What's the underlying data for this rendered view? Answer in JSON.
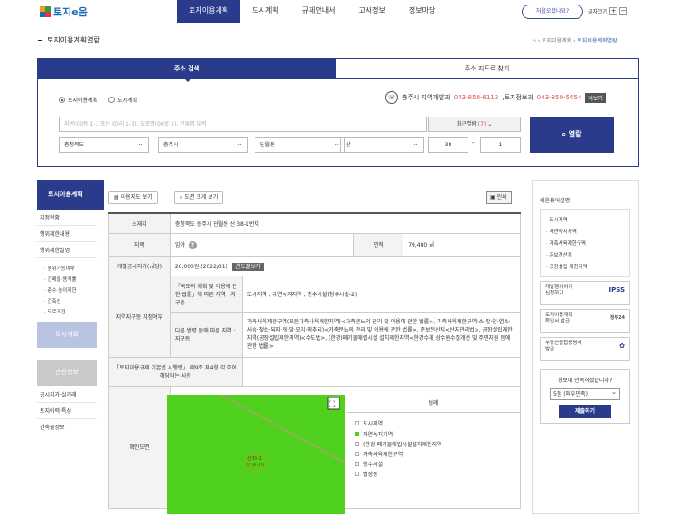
{
  "header": {
    "logo_text": "토지e음",
    "nav": [
      "토지이용계획",
      "도시계획",
      "규제안내서",
      "고시정보",
      "정보마당"
    ],
    "help_button": "처음오셨나요?",
    "font_size_label": "글자크기",
    "font_plus": "+",
    "font_minus": "−"
  },
  "page": {
    "title": "토지이용계획열람",
    "breadcrumb": [
      "토지이용계획",
      "토지이용계획열람"
    ]
  },
  "search": {
    "tab_address": "주소 검색",
    "tab_map": "주소 지도로 찾기",
    "radio_land_use": "토지이용계획",
    "radio_urban": "도시계획",
    "contact_prefix": "충주시 지역개발과",
    "contact_phone1": "043-850-6112",
    "contact_sep": ",토지정보과",
    "contact_phone2": "043-850-5454",
    "contact_more": "더보기",
    "address_placeholder": "지번(00동 1-1 또는 00리 1-1), 도로명(00로 1), 건물명 입력",
    "recent_label": "최근열람",
    "recent_count": "(7)",
    "province": "충청북도",
    "city": "충주시",
    "dong": "단월동",
    "mountain": "산",
    "bunji_main": "38",
    "bunji_dash": "-",
    "bunji_sub": "1",
    "view_button": "열람"
  },
  "lnb": {
    "title": "토지이용계획",
    "items": [
      "지정현황",
      "행위제한내용",
      "행위제한설명"
    ],
    "subitems": [
      "· 행위가능여부",
      "· 건폐율·용적률",
      "· 층수·높이제한",
      "· 건축선",
      "· 도로조건"
    ],
    "box_city": "도시계획",
    "box_info": "관련정보",
    "items2": [
      "공시지가·실거래",
      "토지이력·특성",
      "건축물정보"
    ]
  },
  "toolbar": {
    "land_map_btn": "이용지도 보기",
    "large_map_btn": "도면 크게 보기",
    "print_btn": "인쇄"
  },
  "info": {
    "location_label": "소재지",
    "location_value": "충청북도 충주시 단월동 산 38-1번지",
    "jimok_label": "지목",
    "jimok_value": "임야",
    "area_label": "면적",
    "area_value": "79,480 ㎡",
    "price_label": "개별공시지가(㎡당)",
    "price_value": "26,000원 (2022/01)",
    "price_badge": "연도별보기",
    "zone_label": "지역지구등 지정여부",
    "zone_law1_label": "「국토의 계획 및 이용에 관한 법률」에 따른 지역ㆍ지구등",
    "zone_law1_value": "도시지역 , 자연녹지지역 , 청수시설(청수시설-2)",
    "zone_law2_label": "다른 법령 등에 따른 지역ㆍ지구등",
    "zone_law2_value": "가축사육제한구역(모든가축사육제한지역)<가축분뇨의 관리 및 이용에 관한 법률>, 가축사육제한구역(소·말·양·염소·사슴·젖소·돼지·개·닭·오리·메추리)<가축분뇨의 관리 및 이용에 관한 법률>, 준보전산지<산지관리법>, 공장설립제한지역(공장설립제한지역)<수도법>, (한강)폐기물매립시설 설치제한지역<한강수계 상수원수질개선 및 주민지원 등에 관한 법률>",
    "rule_label": "「토지이용규제 기본법 시행령」 제9조 제4항 각 호에 해당되는 사항",
    "map_label": "확인도면",
    "legend_title": "범례",
    "legend": [
      "도시지역",
      "자연녹지지역",
      "(한강)폐기물매립시설설치제한지역",
      "가축사육제한구역",
      "청수시설",
      "법정동"
    ],
    "legend_colors": [
      "#ffffff",
      "#4fd11e",
      "#ffffff",
      "#ffffff",
      "#ffffff",
      "#ffffff"
    ],
    "map_parcel_label": "산38-1\n산 38-1대"
  },
  "right": {
    "title": "쉬운용어설명",
    "terms": [
      "도시지역",
      "자연녹지지역",
      "가축사육제한구역",
      "준보전산지",
      "공장설립 제한지역"
    ],
    "card1": "개발행위허가\n신청하기",
    "card1_mark": "IPSS",
    "card2": "토지이용계획\n확인서 발급",
    "card2_mark": "정부24",
    "card3": "부동산종합증명서\n발급",
    "survey_q": "정보에 만족하셨습니까?",
    "survey_select": "5점 (매우만족)",
    "survey_btn": "제출하기"
  }
}
